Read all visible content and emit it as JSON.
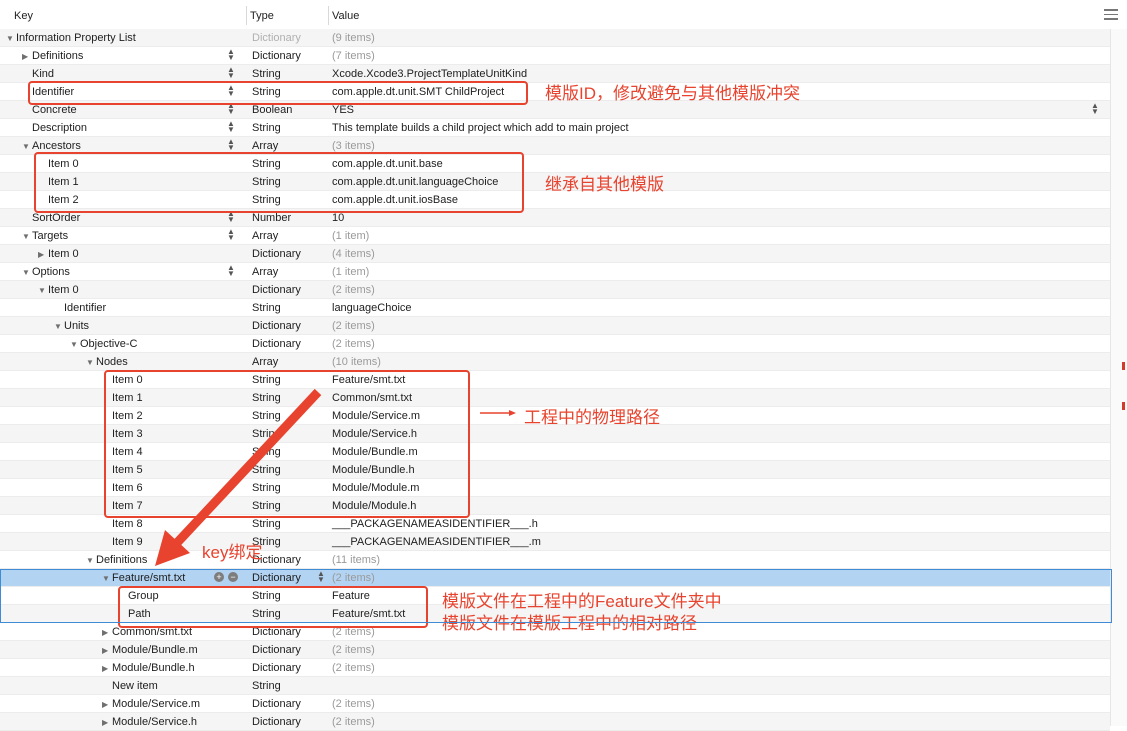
{
  "header": {
    "key": "Key",
    "type": "Type",
    "value": "Value"
  },
  "rows": [
    {
      "key": "Information Property List",
      "type": "Dictionary",
      "value": "(9 items)",
      "dimType": true,
      "dimValue": true,
      "indent": 0,
      "tri": "down"
    },
    {
      "key": "Definitions",
      "type": "Dictionary",
      "value": "(7 items)",
      "dimValue": true,
      "indent": 1,
      "tri": "right",
      "stepper": true
    },
    {
      "key": "Kind",
      "type": "String",
      "value": "Xcode.Xcode3.ProjectTemplateUnitKind",
      "indent": 1,
      "stepper": true
    },
    {
      "key": "Identifier",
      "type": "String",
      "value": "com.apple.dt.unit.SMT ChildProject",
      "indent": 1,
      "stepper": true
    },
    {
      "key": "Concrete",
      "type": "Boolean",
      "value": "YES",
      "indent": 1,
      "stepper": true,
      "valueStepper": true
    },
    {
      "key": "Description",
      "type": "String",
      "value": "This template builds a child project which add to main project",
      "indent": 1,
      "stepper": true
    },
    {
      "key": "Ancestors",
      "type": "Array",
      "value": "(3 items)",
      "dimValue": true,
      "indent": 1,
      "tri": "down",
      "stepper": true
    },
    {
      "key": "Item 0",
      "type": "String",
      "value": "com.apple.dt.unit.base",
      "indent": 2
    },
    {
      "key": "Item 1",
      "type": "String",
      "value": "com.apple.dt.unit.languageChoice",
      "indent": 2
    },
    {
      "key": "Item 2",
      "type": "String",
      "value": "com.apple.dt.unit.iosBase",
      "indent": 2
    },
    {
      "key": "SortOrder",
      "type": "Number",
      "value": "10",
      "indent": 1,
      "stepper": true
    },
    {
      "key": "Targets",
      "type": "Array",
      "value": "(1 item)",
      "dimValue": true,
      "indent": 1,
      "tri": "down",
      "stepper": true
    },
    {
      "key": "Item 0",
      "type": "Dictionary",
      "value": "(4 items)",
      "dimValue": true,
      "indent": 2,
      "tri": "right"
    },
    {
      "key": "Options",
      "type": "Array",
      "value": "(1 item)",
      "dimValue": true,
      "indent": 1,
      "tri": "down",
      "stepper": true
    },
    {
      "key": "Item 0",
      "type": "Dictionary",
      "value": "(2 items)",
      "dimValue": true,
      "indent": 2,
      "tri": "down"
    },
    {
      "key": "Identifier",
      "type": "String",
      "value": "languageChoice",
      "indent": 3
    },
    {
      "key": "Units",
      "type": "Dictionary",
      "value": "(2 items)",
      "dimValue": true,
      "indent": 3,
      "tri": "down"
    },
    {
      "key": "Objective-C",
      "type": "Dictionary",
      "value": "(2 items)",
      "dimValue": true,
      "indent": 4,
      "tri": "down"
    },
    {
      "key": "Nodes",
      "type": "Array",
      "value": "(10 items)",
      "dimValue": true,
      "indent": 5,
      "tri": "down"
    },
    {
      "key": "Item 0",
      "type": "String",
      "value": "Feature/smt.txt",
      "indent": 6
    },
    {
      "key": "Item 1",
      "type": "String",
      "value": "Common/smt.txt",
      "indent": 6
    },
    {
      "key": "Item 2",
      "type": "String",
      "value": "Module/Service.m",
      "indent": 6
    },
    {
      "key": "Item 3",
      "type": "String",
      "value": "Module/Service.h",
      "indent": 6
    },
    {
      "key": "Item 4",
      "type": "String",
      "value": "Module/Bundle.m",
      "indent": 6
    },
    {
      "key": "Item 5",
      "type": "String",
      "value": "Module/Bundle.h",
      "indent": 6
    },
    {
      "key": "Item 6",
      "type": "String",
      "value": "Module/Module.m",
      "indent": 6
    },
    {
      "key": "Item 7",
      "type": "String",
      "value": "Module/Module.h",
      "indent": 6
    },
    {
      "key": "Item 8",
      "type": "String",
      "value": "___PACKAGENAMEASIDENTIFIER___.h",
      "indent": 6
    },
    {
      "key": "Item 9",
      "type": "String",
      "value": "___PACKAGENAMEASIDENTIFIER___.m",
      "indent": 6
    },
    {
      "key": "Definitions",
      "type": "Dictionary",
      "value": "(11 items)",
      "dimValue": true,
      "indent": 5,
      "tri": "down"
    },
    {
      "key": "Feature/smt.txt",
      "type": "Dictionary",
      "value": "(2 items)",
      "dimValue": true,
      "indent": 6,
      "tri": "down",
      "selected": true,
      "addRemove": true
    },
    {
      "key": "Group",
      "type": "String",
      "value": "Feature",
      "indent": 7
    },
    {
      "key": "Path",
      "type": "String",
      "value": "Feature/smt.txt",
      "indent": 7
    },
    {
      "key": "Common/smt.txt",
      "type": "Dictionary",
      "value": "(2 items)",
      "dimValue": true,
      "indent": 6,
      "tri": "right"
    },
    {
      "key": "Module/Bundle.m",
      "type": "Dictionary",
      "value": "(2 items)",
      "dimValue": true,
      "indent": 6,
      "tri": "right"
    },
    {
      "key": "Module/Bundle.h",
      "type": "Dictionary",
      "value": "(2 items)",
      "dimValue": true,
      "indent": 6,
      "tri": "right"
    },
    {
      "key": "New item",
      "type": "String",
      "value": "",
      "indent": 6
    },
    {
      "key": "Module/Service.m",
      "type": "Dictionary",
      "value": "(2 items)",
      "dimValue": true,
      "indent": 6,
      "tri": "right"
    },
    {
      "key": "Module/Service.h",
      "type": "Dictionary",
      "value": "(2 items)",
      "dimValue": true,
      "indent": 6,
      "tri": "right"
    }
  ],
  "annotations": {
    "identifier": "模版ID，修改避免与其他模版冲突",
    "ancestors": "继承自其他模版",
    "nodes": "工程中的物理路径",
    "key_binding": "key绑定",
    "group": "模版文件在工程中的Feature文件夹中",
    "path": "模版文件在模版工程中的相对路径"
  },
  "colors": {
    "annotation": "#e8432e",
    "selection": "#b3d3f2",
    "selection_border": "#3f8bd6"
  }
}
